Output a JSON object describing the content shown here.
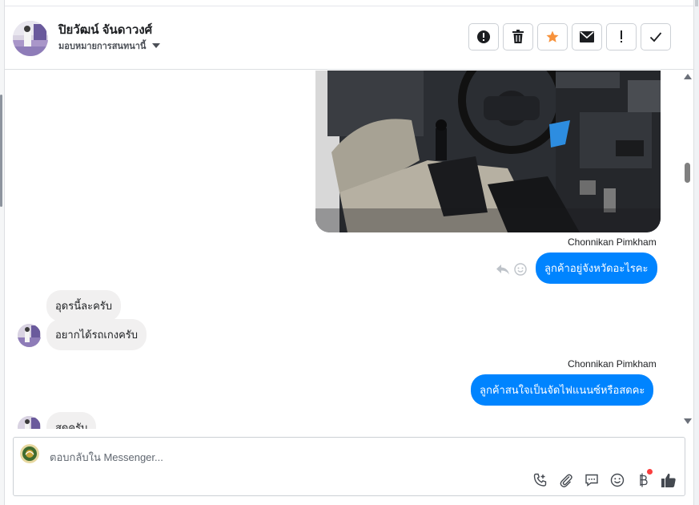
{
  "header": {
    "name": "ปิยวัฒน์ จันดาวงศ์",
    "assign_label": "มอบหมายการสนทนานี้",
    "tools": [
      {
        "icon": "alert-circle-icon",
        "name": "spam-button"
      },
      {
        "icon": "trash-icon",
        "name": "delete-button"
      },
      {
        "icon": "star-icon",
        "name": "star-button"
      },
      {
        "icon": "envelope-icon",
        "name": "mark-unread-button"
      },
      {
        "icon": "exclamation-icon",
        "name": "follow-up-button"
      },
      {
        "icon": "check-icon",
        "name": "mark-done-button"
      }
    ],
    "star_color": "#f7923b"
  },
  "thread": {
    "messages": [
      {
        "sender": "Chonnikan Pimkham",
        "text": "ลูกค้าอยู่จังหวัดอะไรคะ",
        "direction": "out"
      },
      {
        "text": "อุดรนี้ละครับ",
        "direction": "in"
      },
      {
        "text": "อยากได้รถเกงครับ",
        "direction": "in"
      },
      {
        "sender": "Chonnikan Pimkham",
        "text": "ลูกค้าสนใจเป็นจัดไฟแนนซ์หรือสดคะ",
        "direction": "out"
      },
      {
        "text": "สดครับ",
        "direction": "in"
      }
    ],
    "accent": "#0084ff"
  },
  "composer": {
    "placeholder": "ตอบกลับใน Messenger..."
  }
}
